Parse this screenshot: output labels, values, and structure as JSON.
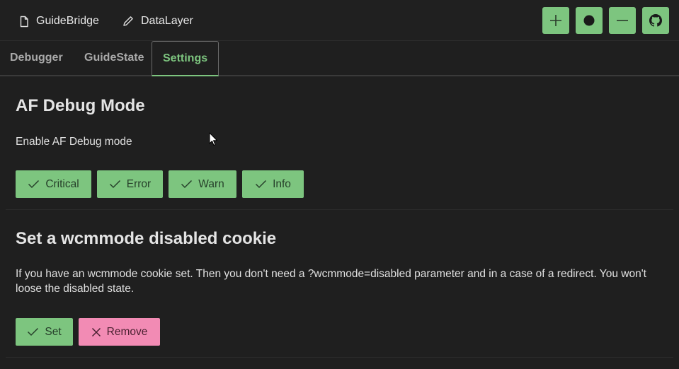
{
  "header": {
    "nav": [
      {
        "label": "GuideBridge",
        "icon": "file-icon"
      },
      {
        "label": "DataLayer",
        "icon": "pencil-icon"
      }
    ],
    "actions": [
      {
        "icon": "plus-icon"
      },
      {
        "icon": "record-icon"
      },
      {
        "icon": "minus-icon"
      },
      {
        "icon": "github-icon"
      }
    ],
    "accent_color": "#7dc57f"
  },
  "tabs": [
    {
      "label": "Debugger",
      "active": false
    },
    {
      "label": "GuideState",
      "active": false
    },
    {
      "label": "Settings",
      "active": true
    }
  ],
  "debug_section": {
    "title": "AF Debug Mode",
    "description": "Enable AF Debug mode",
    "buttons": [
      {
        "label": "Critical",
        "icon": "check-icon"
      },
      {
        "label": "Error",
        "icon": "check-icon"
      },
      {
        "label": "Warn",
        "icon": "check-icon"
      },
      {
        "label": "Info",
        "icon": "check-icon"
      }
    ]
  },
  "cookie_section": {
    "title": "Set a wcmmode disabled cookie",
    "description": "If you have an wcmmode cookie set. Then you don't need a ?wcmmode=disabled parameter and in a case of a redirect. You won't loose the disabled state.",
    "buttons": [
      {
        "label": "Set",
        "icon": "check-icon",
        "color": "#7dc57f"
      },
      {
        "label": "Remove",
        "icon": "close-icon",
        "color": "#f28bb4"
      }
    ]
  }
}
